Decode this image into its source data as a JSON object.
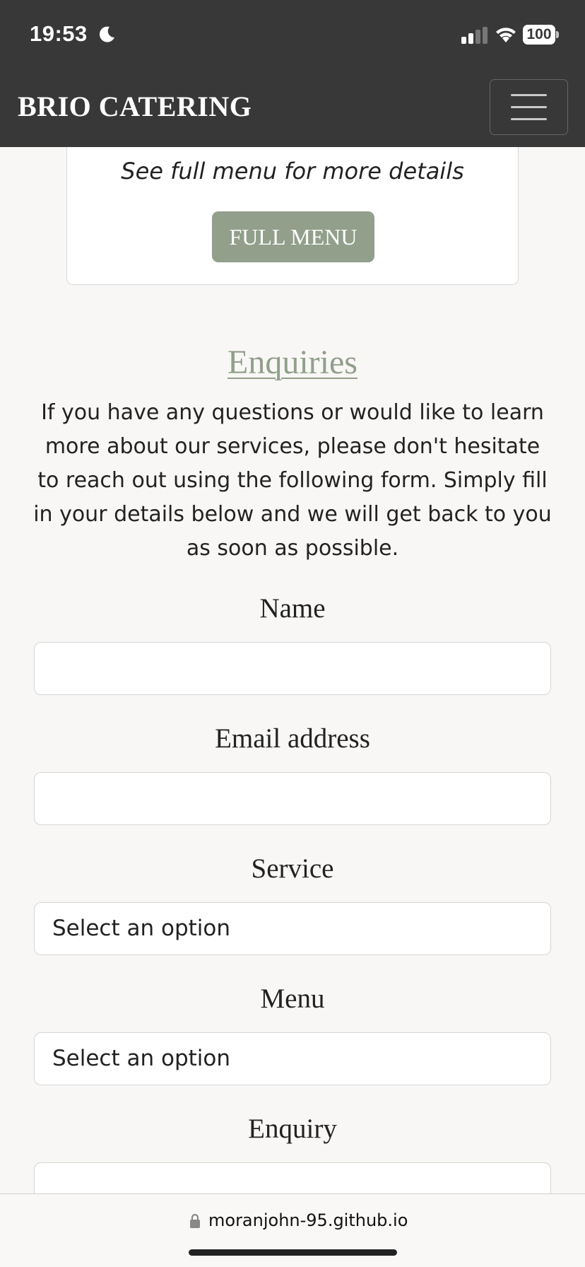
{
  "status_bar": {
    "time": "19:53",
    "battery": "100",
    "icons": [
      "moon-icon",
      "signal-icon",
      "wifi-icon",
      "battery-icon"
    ]
  },
  "navbar": {
    "brand": "BRIO CATERING",
    "toggle_icon": "hamburger-icon"
  },
  "menu_card": {
    "note": "See full menu for more details",
    "button_label": "FULL MENU"
  },
  "enquiries": {
    "title": "Enquiries",
    "intro": "If you have any questions or would like to learn more about our services, please don't hesitate to reach out using the following form. Simply fill in your details below and we will get back to you as soon as possible.",
    "fields": {
      "name": {
        "label": "Name",
        "value": ""
      },
      "email": {
        "label": "Email address",
        "value": ""
      },
      "service": {
        "label": "Service",
        "selected": "Select an option"
      },
      "menu": {
        "label": "Menu",
        "selected": "Select an option"
      },
      "enquiry": {
        "label": "Enquiry",
        "value": ""
      }
    }
  },
  "browser": {
    "url": "moranjohn-95.github.io"
  },
  "colors": {
    "navbar_bg": "#383838",
    "accent": "#919f8b",
    "page_bg": "#f8f7f5"
  }
}
